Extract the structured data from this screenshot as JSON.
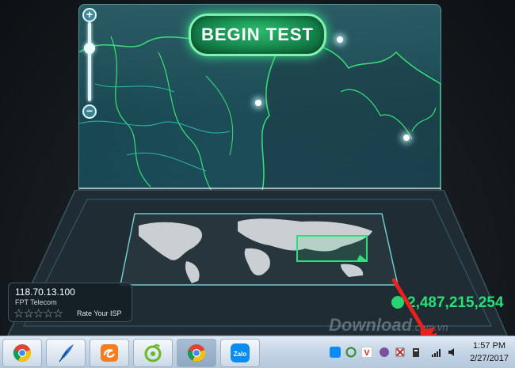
{
  "speedtest": {
    "begin_button": "BEGIN TEST",
    "zoom_in": "+",
    "zoom_out": "−",
    "ip_address": "118.70.13.100",
    "isp": "FPT Telecom",
    "rate_label": "Rate Your ISP",
    "rating_stars": 5,
    "tests_count": "2,487,215,254",
    "accent_color": "#28e07a"
  },
  "watermark": {
    "main": "Download",
    "suffix": ".com.vn"
  },
  "taskbar": {
    "apps": [
      "chrome-icon",
      "feather-icon",
      "uc-browser-icon",
      "coccoc-icon",
      "chrome-icon",
      "zalo-icon"
    ],
    "zalo_label": "Zalo",
    "tray_icons": [
      "zalo-tray-icon",
      "refresh-icon",
      "vietkey-icon",
      "viber-icon",
      "flag-icon",
      "power-icon",
      "network-icon",
      "volume-icon"
    ],
    "vietkey_label": "V",
    "time": "1:57 PM",
    "date": "2/27/2017"
  }
}
